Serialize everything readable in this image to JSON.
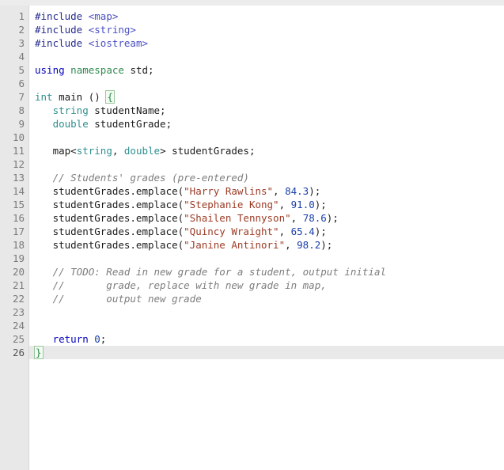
{
  "editor": {
    "language": "C++",
    "gutter_background": "#e8e8e8",
    "code_background": "#ffffff",
    "active_line": 26,
    "total_lines": 26,
    "line_numbers": [
      "1",
      "2",
      "3",
      "4",
      "5",
      "6",
      "7",
      "8",
      "9",
      "10",
      "11",
      "12",
      "13",
      "14",
      "15",
      "16",
      "17",
      "18",
      "19",
      "20",
      "21",
      "22",
      "23",
      "24",
      "25",
      "26"
    ],
    "colors": {
      "preprocessor": "#252b8f",
      "header": "#4a4fc0",
      "keyword": "#0000c0",
      "namespace": "#2f8a4f",
      "type": "#2f8f8f",
      "string": "#9c3b25",
      "number": "#1a3fa8",
      "comment": "#7d7d7d",
      "brace_match": "#2f8a4f",
      "plain": "#1b1b1b"
    },
    "lines": [
      {
        "n": "1",
        "text": "#include <map>"
      },
      {
        "n": "2",
        "text": "#include <string>"
      },
      {
        "n": "3",
        "text": "#include <iostream>"
      },
      {
        "n": "4",
        "text": ""
      },
      {
        "n": "5",
        "text": "using namespace std;"
      },
      {
        "n": "6",
        "text": ""
      },
      {
        "n": "7",
        "text": "int main () {"
      },
      {
        "n": "8",
        "text": "   string studentName;"
      },
      {
        "n": "9",
        "text": "   double studentGrade;"
      },
      {
        "n": "10",
        "text": ""
      },
      {
        "n": "11",
        "text": "   map<string, double> studentGrades;"
      },
      {
        "n": "12",
        "text": ""
      },
      {
        "n": "13",
        "text": "   // Students' grades (pre-entered)"
      },
      {
        "n": "14",
        "text": "   studentGrades.emplace(\"Harry Rawlins\", 84.3);"
      },
      {
        "n": "15",
        "text": "   studentGrades.emplace(\"Stephanie Kong\", 91.0);"
      },
      {
        "n": "16",
        "text": "   studentGrades.emplace(\"Shailen Tennyson\", 78.6);"
      },
      {
        "n": "17",
        "text": "   studentGrades.emplace(\"Quincy Wraight\", 65.4);"
      },
      {
        "n": "18",
        "text": "   studentGrades.emplace(\"Janine Antinori\", 98.2);"
      },
      {
        "n": "19",
        "text": ""
      },
      {
        "n": "20",
        "text": "   // TODO: Read in new grade for a student, output initial"
      },
      {
        "n": "21",
        "text": "   //       grade, replace with new grade in map,"
      },
      {
        "n": "22",
        "text": "   //       output new grade"
      },
      {
        "n": "23",
        "text": ""
      },
      {
        "n": "24",
        "text": ""
      },
      {
        "n": "25",
        "text": "   return 0;"
      },
      {
        "n": "26",
        "text": "}"
      }
    ],
    "tokens": {
      "l1": {
        "directive": "#include",
        "header": "<map>"
      },
      "l2": {
        "directive": "#include",
        "header": "<string>"
      },
      "l3": {
        "directive": "#include",
        "header": "<iostream>"
      },
      "l5": {
        "using": "using",
        "namespace": "namespace",
        "std": "std;"
      },
      "l7": {
        "int": "int",
        "main": " main () ",
        "brace": "{"
      },
      "l8": {
        "type": "string",
        "rest": " studentName;"
      },
      "l9": {
        "type": "double",
        "rest": " studentGrade;"
      },
      "l11": {
        "map": "map<",
        "t1": "string",
        "comma": ", ",
        "t2": "double",
        "rest": "> studentGrades;"
      },
      "l13": {
        "comment": "// Students' grades (pre-entered)"
      },
      "l14": {
        "call": "studentGrades.emplace(",
        "str": "\"Harry Rawlins\"",
        "sep": ", ",
        "num": "84.3",
        "end": ");"
      },
      "l15": {
        "call": "studentGrades.emplace(",
        "str": "\"Stephanie Kong\"",
        "sep": ", ",
        "num": "91.0",
        "end": ");"
      },
      "l16": {
        "call": "studentGrades.emplace(",
        "str": "\"Shailen Tennyson\"",
        "sep": ", ",
        "num": "78.6",
        "end": ");"
      },
      "l17": {
        "call": "studentGrades.emplace(",
        "str": "\"Quincy Wraight\"",
        "sep": ", ",
        "num": "65.4",
        "end": ");"
      },
      "l18": {
        "call": "studentGrades.emplace(",
        "str": "\"Janine Antinori\"",
        "sep": ", ",
        "num": "98.2",
        "end": ");"
      },
      "l20": {
        "comment": "// TODO: Read in new grade for a student, output initial"
      },
      "l21": {
        "comment": "//       grade, replace with new grade in map,"
      },
      "l22": {
        "comment": "//       output new grade"
      },
      "l25": {
        "kw": "return",
        "num": " 0",
        "end": ";"
      },
      "l26": {
        "brace": "}"
      }
    }
  }
}
